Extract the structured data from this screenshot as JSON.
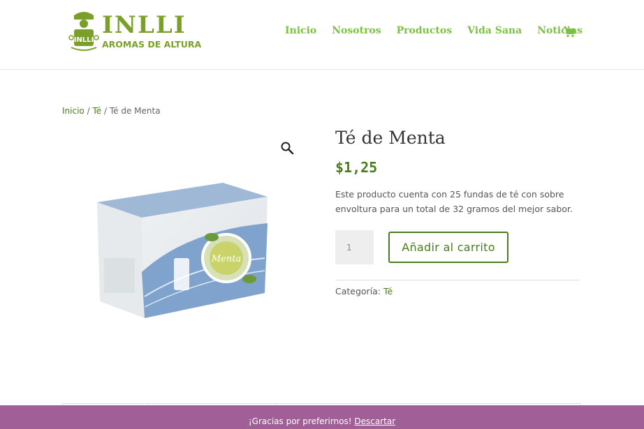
{
  "brand": {
    "title": "INLLI",
    "subtitle": "AROMAS DE ALTURA",
    "color": "#7aa02a"
  },
  "nav": {
    "items": [
      "Inicio",
      "Nosotros",
      "Productos",
      "Vida Sana",
      "Noticias"
    ],
    "cart_icon": "shopping-cart-icon",
    "color": "#7cc242"
  },
  "breadcrumb": {
    "home": "Inicio",
    "sep1": "/",
    "category": "Té",
    "sep2": "/",
    "current": "Té de Menta"
  },
  "gallery": {
    "zoom_icon": "magnifier-icon",
    "box_text": "Menta"
  },
  "product": {
    "title": "Té de Menta",
    "price": "$1,25",
    "description": "Este producto cuenta con 25 fundas de té con sobre envoltura para un total de 32 gramos del mejor sabor.",
    "quantity": "1",
    "add_to_cart": "Añadir al carrito",
    "category_label": "Categoría:",
    "category_value": "Té",
    "accent": "#4a7c1f"
  },
  "notice": {
    "text": "¡Gracias por preferirnos!",
    "dismiss": "Descartar",
    "color": "#a05f96"
  }
}
